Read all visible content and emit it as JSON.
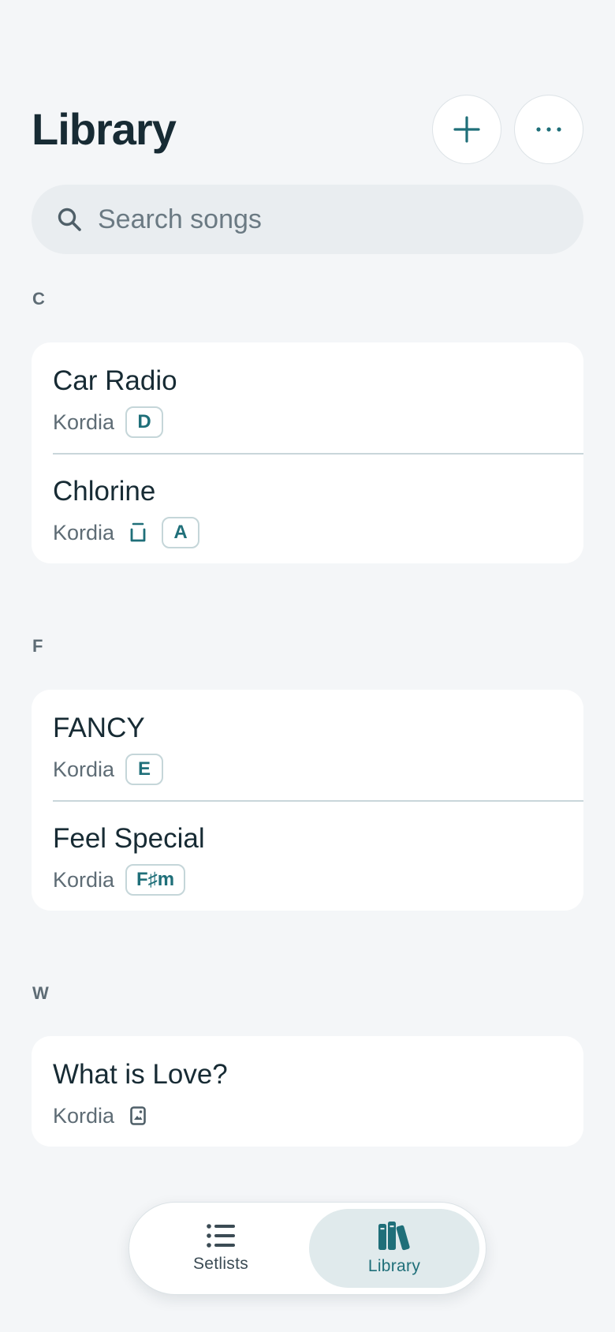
{
  "header": {
    "title": "Library",
    "add_icon": "plus-icon",
    "more_icon": "ellipsis-icon"
  },
  "search": {
    "placeholder": "Search songs",
    "value": ""
  },
  "sections": [
    {
      "letter": "C",
      "songs": [
        {
          "title": "Car Radio",
          "artist": "Kordia",
          "key": "D",
          "icons": []
        },
        {
          "title": "Chlorine",
          "artist": "Kordia",
          "key": "A",
          "icons": [
            "lowered-bracket-icon"
          ]
        }
      ]
    },
    {
      "letter": "F",
      "songs": [
        {
          "title": "FANCY",
          "artist": "Kordia",
          "key": "E",
          "icons": []
        },
        {
          "title": "Feel Special",
          "artist": "Kordia",
          "key": "F♯m",
          "icons": []
        }
      ]
    },
    {
      "letter": "W",
      "songs": [
        {
          "title": "What is Love?",
          "artist": "Kordia",
          "key": "",
          "icons": [
            "image-file-icon"
          ]
        }
      ]
    }
  ],
  "bottom_nav": {
    "items": [
      {
        "label": "Setlists",
        "icon": "list-icon",
        "active": false
      },
      {
        "label": "Library",
        "icon": "books-icon",
        "active": true
      }
    ]
  },
  "colors": {
    "accent": "#1f6f79",
    "background": "#f4f6f8",
    "card": "#ffffff",
    "nav_active_bg": "#e0eaec"
  }
}
